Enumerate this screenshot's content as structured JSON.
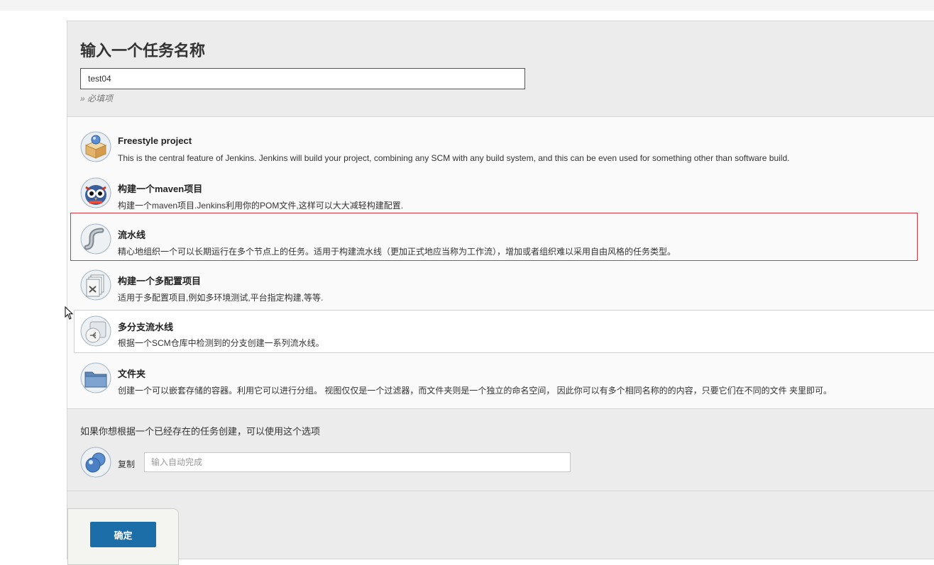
{
  "page": {
    "title": "输入一个任务名称",
    "item_name": {
      "value": "test04",
      "required_hint": "» 必填项"
    }
  },
  "item_types": [
    {
      "label": "Freestyle project",
      "description": "This is the central feature of Jenkins. Jenkins will build your project, combining any SCM with any build system, and this can be even used for something other than software build.",
      "icon": "freestyle-package-icon"
    },
    {
      "label": "构建一个maven项目",
      "description": "构建一个maven项目.Jenkins利用你的POM文件,这样可以大大减轻构建配置.",
      "icon": "maven-owl-icon"
    },
    {
      "label": "流水线",
      "description": "精心地组织一个可以长期运行在多个节点上的任务。适用于构建流水线（更加正式地应当称为工作流），增加或者组织难以采用自由风格的任务类型。",
      "icon": "pipeline-pipe-icon",
      "highlighted": true
    },
    {
      "label": "构建一个多配置项目",
      "description": "适用于多配置项目,例如多环境测试,平台指定构建,等等.",
      "icon": "multi-config-icon"
    },
    {
      "label": "多分支流水线",
      "description": "根据一个SCM仓库中检测到的分支创建一系列流水线。",
      "icon": "multibranch-pipeline-icon",
      "hovered": true
    },
    {
      "label": "文件夹",
      "description": "创建一个可以嵌套存储的容器。利用它可以进行分组。 视图仅仅是一个过滤器，而文件夹则是一个独立的命名空间， 因此你可以有多个相同名称的的内容，只要它们在不同的文件 夹里即可。",
      "icon": "folder-icon"
    }
  ],
  "copy_section": {
    "hint": "如果你想根据一个已经存在的任务创建，可以使用这个选项",
    "label": "复制",
    "placeholder": "输入自动完成",
    "icon": "copy-globe-icon"
  },
  "footer": {
    "ok_label": "确定"
  },
  "colors": {
    "accent": "#1b6ea8",
    "highlight": "#d9363e",
    "panel": "#ececec"
  }
}
